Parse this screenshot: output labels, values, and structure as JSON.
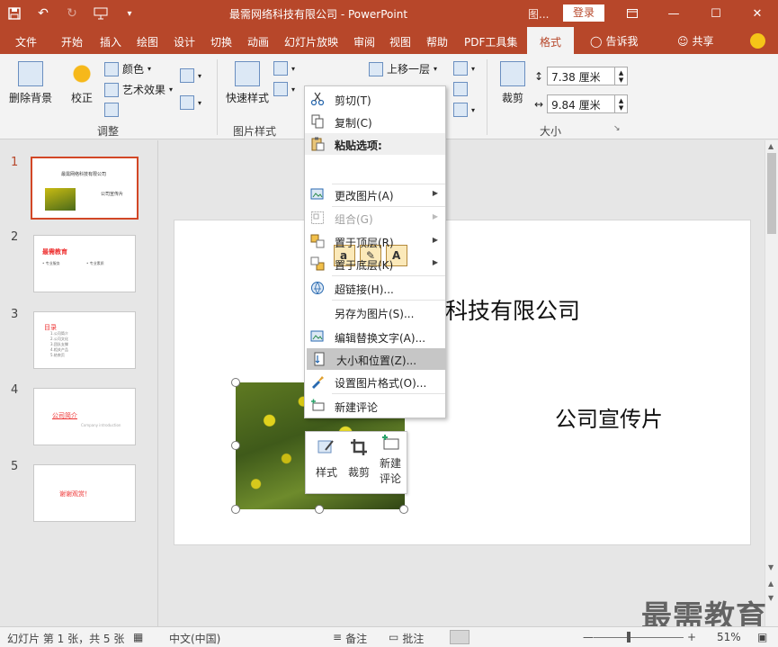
{
  "window": {
    "title": "最需网络科技有限公司  -  PowerPoint",
    "context_tab_title": "图...",
    "login": "登录"
  },
  "tabs": {
    "items": [
      "文件",
      "开始",
      "插入",
      "绘图",
      "设计",
      "切换",
      "动画",
      "幻灯片放映",
      "审阅",
      "视图",
      "帮助",
      "PDF工具集"
    ],
    "active": "格式",
    "tell_me": "告诉我",
    "share": "共享"
  },
  "ribbon": {
    "remove_bg": "删除背景",
    "corrections": "校正",
    "color": "颜色",
    "artistic": "艺术效果",
    "adjust_group": "调整",
    "quick_styles": "快速样式",
    "picture_styles_group": "图片样式",
    "bring_forward": "上移一层",
    "crop": "裁剪",
    "height_value": "7.38 厘米",
    "width_value": "9.84 厘米",
    "size_group": "大小"
  },
  "thumbnails": [
    {
      "num": "1",
      "title": "最需网络科技有限公司",
      "subtitle": "公司宣传片"
    },
    {
      "num": "2",
      "title": "最需教育",
      "left": "• 专业服务",
      "right": "• 专业素质"
    },
    {
      "num": "3",
      "title": "目录",
      "items": [
        "1.公司简介",
        "2.公司文化",
        "3.团队支撑",
        "4.相关产品",
        "5.结束页"
      ]
    },
    {
      "num": "4",
      "title": "公司简介",
      "subtitle": "Company introduction"
    },
    {
      "num": "5",
      "title": "谢谢观赏！"
    }
  ],
  "slide": {
    "title": "科技有限公司",
    "subtitle": "公司宣传片"
  },
  "mini_toolbar": {
    "style": "样式",
    "crop": "裁剪",
    "new_comment_line1": "新建",
    "new_comment_line2": "评论"
  },
  "context_menu": {
    "cut": "剪切(T)",
    "copy": "复制(C)",
    "paste_options": "粘贴选项:",
    "change_picture": "更改图片(A)",
    "group": "组合(G)",
    "bring_to_front": "置于顶层(R)",
    "send_to_back": "置于底层(K)",
    "hyperlink": "超链接(H)...",
    "save_as_picture": "另存为图片(S)...",
    "edit_alt_text": "编辑替换文字(A)...",
    "size_position": "大小和位置(Z)...",
    "format_picture": "设置图片格式(O)...",
    "new_comment": "新建评论"
  },
  "status": {
    "slide_info": "幻灯片 第 1 张，共 5 张",
    "language": "中文(中国)",
    "notes": "备注",
    "comments": "批注",
    "zoom": "51%"
  },
  "watermark": "最需教育",
  "colors": {
    "accent": "#b7472a",
    "selected_thumb_border": "#d24726"
  }
}
